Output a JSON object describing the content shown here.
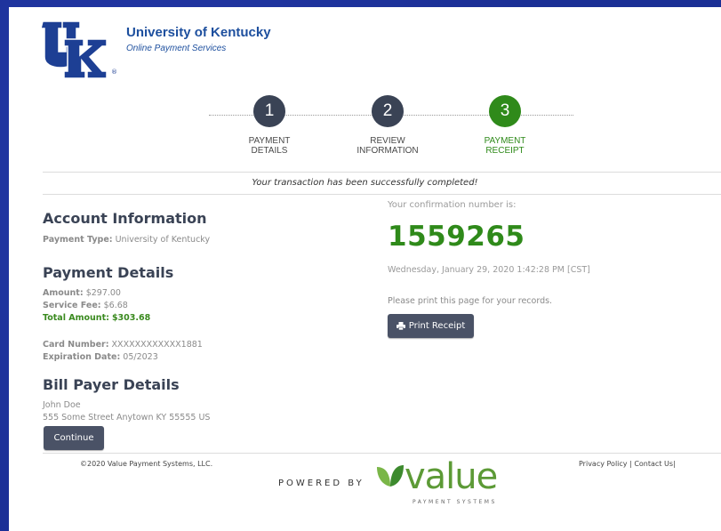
{
  "header": {
    "title": "University of Kentucky",
    "subtitle": "Online Payment Services",
    "logo_text": "UK",
    "logo_mark": "®"
  },
  "stepper": {
    "steps": [
      {
        "number": "1",
        "line1": "PAYMENT",
        "line2": "DETAILS",
        "state": "complete"
      },
      {
        "number": "2",
        "line1": "REVIEW",
        "line2": "INFORMATION",
        "state": "complete"
      },
      {
        "number": "3",
        "line1": "PAYMENT",
        "line2": "RECEIPT",
        "state": "active"
      }
    ],
    "colors": {
      "complete": "#3a4355",
      "active": "#2f8a1a"
    }
  },
  "success_message": "Your transaction has been successfully completed!",
  "account": {
    "heading": "Account Information",
    "payment_type_label": "Payment Type:",
    "payment_type_value": "University of Kentucky"
  },
  "payment": {
    "heading": "Payment Details",
    "amount_label": "Amount:",
    "amount_value": "$297.00",
    "fee_label": "Service Fee:",
    "fee_value": "$6.68",
    "total_label": "Total Amount:",
    "total_value": "$303.68",
    "card_label": "Card Number:",
    "card_value": "XXXXXXXXXXXX1881",
    "exp_label": "Expiration Date:",
    "exp_value": "05/2023"
  },
  "bill_payer": {
    "heading": "Bill Payer Details",
    "name": "John Doe",
    "address": "555 Some Street Anytown KY 55555 US"
  },
  "buttons": {
    "continue": "Continue",
    "print_receipt": "Print Receipt"
  },
  "confirmation": {
    "label": "Your confirmation number is:",
    "number": "1559265",
    "datetime": "Wednesday, January 29, 2020 1:42:28 PM [CST]",
    "print_note": "Please print this page for your records."
  },
  "footer": {
    "copyright": "©2020 Value Payment Systems, LLC.",
    "privacy": "Privacy Policy",
    "separator": "|",
    "contact": "Contact Us",
    "trailing_sep": "|",
    "powered_by": "POWERED BY",
    "brand_word": "value",
    "brand_sub": "PAYMENT SYSTEMS"
  },
  "colors": {
    "background": "#1b2f95",
    "brand_blue": "#1d4f9e",
    "success_green": "#2f8a1a",
    "button_dark": "#4a5266",
    "value_green": "#5c9a36"
  }
}
